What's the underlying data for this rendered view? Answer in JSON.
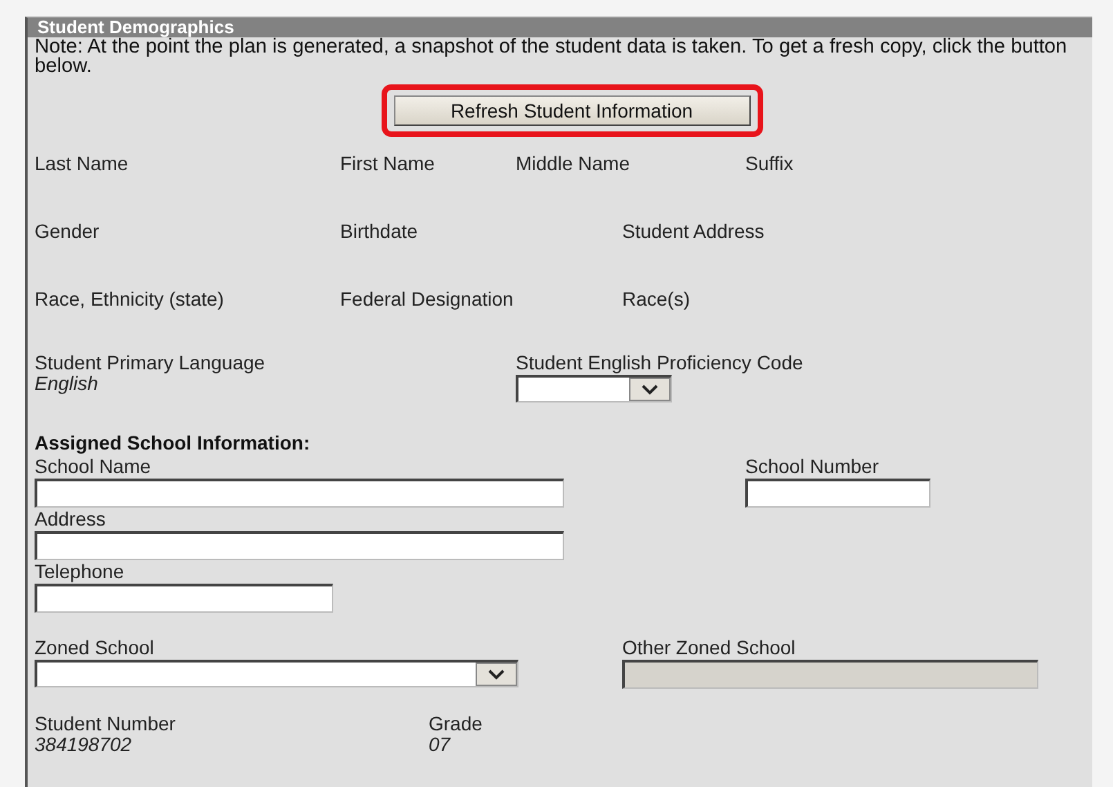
{
  "panel": {
    "title": "Student Demographics",
    "note": "Note: At the point the plan is generated, a snapshot of the student data is taken. To get a fresh copy, click the button below.",
    "refresh_button": {
      "label": "Refresh Student Information",
      "highlighted": true
    },
    "rows": [
      {
        "fields": [
          {
            "kind": "label",
            "label": "Last Name"
          },
          {
            "kind": "label",
            "label": "First Name"
          },
          {
            "kind": "label",
            "label": "Middle Name"
          },
          {
            "kind": "label",
            "label": "Suffix"
          }
        ]
      },
      {
        "fields": [
          {
            "kind": "label",
            "label": "Gender"
          },
          {
            "kind": "label",
            "label": "Birthdate"
          },
          {
            "kind": "label",
            "label": "Student Address"
          }
        ]
      },
      {
        "fields": [
          {
            "kind": "label",
            "label": "Race, Ethnicity (state)"
          },
          {
            "kind": "label",
            "label": "Federal Designation"
          },
          {
            "kind": "label",
            "label": "Race(s)"
          }
        ]
      },
      {
        "fields": [
          {
            "kind": "value",
            "label": "Student Primary Language",
            "value": "English"
          },
          {
            "kind": "select",
            "label": "Student English Proficiency Code"
          }
        ]
      },
      {
        "kind": "heading",
        "text": "Assigned School Information:"
      },
      {
        "fields": [
          {
            "kind": "input",
            "label": "School Name"
          },
          {
            "kind": "input",
            "label": "School Number"
          }
        ]
      },
      {
        "fields": [
          {
            "kind": "input",
            "label": "Address"
          }
        ]
      },
      {
        "fields": [
          {
            "kind": "input",
            "label": "Telephone"
          }
        ]
      },
      {
        "fields": [
          {
            "kind": "select",
            "label": "Zoned School"
          },
          {
            "kind": "input",
            "label": "Other Zoned School",
            "disabled": true
          }
        ]
      },
      {
        "fields": [
          {
            "kind": "value",
            "label": "Student Number",
            "value": "384198702"
          },
          {
            "kind": "value",
            "label": "Grade",
            "value": "07"
          }
        ]
      }
    ]
  }
}
